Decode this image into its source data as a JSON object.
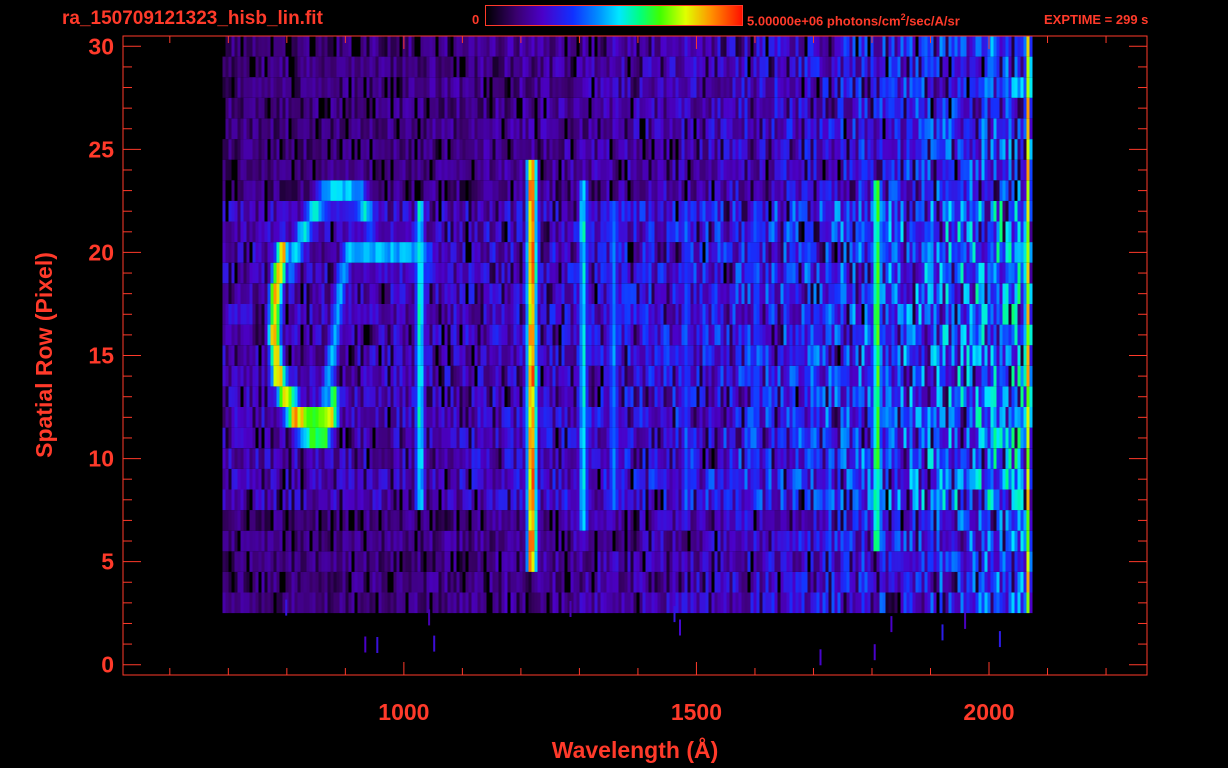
{
  "header": {
    "file_title": "ra_150709121323_hisb_lin.fit",
    "colorbar_min": "0",
    "colorbar_max": "5.00000e+06 photons/cm",
    "colorbar_max_sup": "2",
    "colorbar_max_suffix": "/sec/A/sr",
    "exptime": "EXPTIME = 299 s"
  },
  "colors": {
    "axis": "#ff3a2a",
    "background": "#000000"
  },
  "chart_data": {
    "type": "heatmap",
    "colormap": "rainbow",
    "xlabel": "Wavelength (Å)",
    "ylabel": "Spatial Row (Pixel)",
    "xlim": [
      520,
      2270
    ],
    "ylim": [
      -0.5,
      30.5
    ],
    "xticks": [
      1000,
      1500,
      2000
    ],
    "xtick_labels": [
      "1000",
      "1500",
      "2000"
    ],
    "yticks": [
      0,
      5,
      10,
      15,
      20,
      25,
      30
    ],
    "ytick_labels": [
      "0",
      "5",
      "10",
      "15",
      "20",
      "25",
      "30"
    ],
    "colorbar_range": [
      0,
      5000000
    ],
    "data_extent": {
      "x": [
        690,
        2070
      ],
      "rows": [
        3,
        30
      ]
    },
    "features": [
      {
        "kind": "emission_line",
        "wavelength": 1216,
        "rows": [
          5,
          24
        ],
        "peak": 0.92
      },
      {
        "kind": "emission_line",
        "wavelength": 1025,
        "rows": [
          8,
          22
        ],
        "peak": 0.52
      },
      {
        "kind": "emission_line",
        "wavelength": 1304,
        "rows": [
          7,
          23
        ],
        "peak": 0.5
      },
      {
        "kind": "emission_line",
        "wavelength": 1356,
        "rows": [
          8,
          22
        ],
        "peak": 0.4
      },
      {
        "kind": "emission_line",
        "wavelength": 1480,
        "rows": [
          8,
          22
        ],
        "peak": 0.34
      },
      {
        "kind": "emission_line",
        "wavelength": 1600,
        "rows": [
          8,
          22
        ],
        "peak": 0.32
      },
      {
        "kind": "emission_line",
        "wavelength": 1806,
        "rows": [
          6,
          23
        ],
        "peak": 0.62
      },
      {
        "kind": "edge_line",
        "wavelength": 2065,
        "rows": [
          1,
          30
        ],
        "peak": 0.85
      },
      {
        "kind": "arc_bright",
        "points": [
          [
            790,
            20
          ],
          [
            778,
            18
          ],
          [
            776,
            16
          ],
          [
            782,
            14
          ],
          [
            795,
            13
          ],
          [
            815,
            12
          ],
          [
            840,
            11.5
          ],
          [
            862,
            11.5
          ],
          [
            877,
            12.5
          ]
        ],
        "peak": 0.85
      },
      {
        "kind": "arc",
        "points": [
          [
            806,
            19.5
          ],
          [
            825,
            21
          ],
          [
            845,
            22
          ],
          [
            870,
            22.8
          ],
          [
            900,
            22.8
          ],
          [
            925,
            22.5
          ],
          [
            940,
            21.5
          ]
        ],
        "peak": 0.5
      },
      {
        "kind": "arc",
        "points": [
          [
            845,
            11
          ],
          [
            865,
            13
          ],
          [
            880,
            16
          ],
          [
            890,
            18.5
          ],
          [
            902,
            20
          ],
          [
            925,
            20
          ],
          [
            960,
            20
          ],
          [
            1000,
            20
          ],
          [
            1040,
            19.5
          ]
        ],
        "peak": 0.45
      }
    ]
  }
}
